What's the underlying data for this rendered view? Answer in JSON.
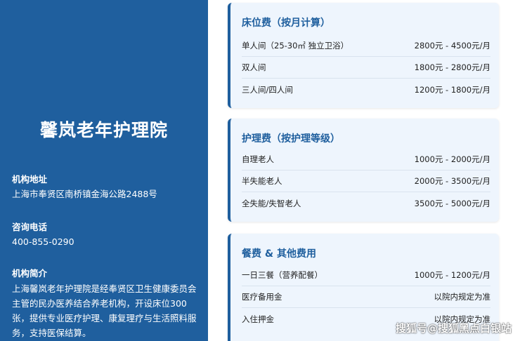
{
  "org": {
    "name": "馨岚老年护理院",
    "address_label": "机构地址",
    "address": "上海市奉贤区南桥镇金海公路2488号",
    "phone_label": "咨询电话",
    "phone": "400-855-0290",
    "intro_label": "机构简介",
    "intro": "上海馨岚老年护理院是经奉贤区卫生健康委员会主管的民办医养结合养老机构，开设床位300张，提供专业医疗护理、康复理疗与生活照料服务，支持医保结算。"
  },
  "cards": [
    {
      "title": "床位费（按月计算）",
      "rows": [
        {
          "name": "单人间（25-30㎡ 独立卫浴）",
          "price": "2800元 - 4500元/月"
        },
        {
          "name": "双人间",
          "price": "1800元 - 2800元/月"
        },
        {
          "name": "三人间/四人间",
          "price": "1200元 - 1800元/月"
        }
      ]
    },
    {
      "title": "护理费（按护理等级）",
      "rows": [
        {
          "name": "自理老人",
          "price": "1000元 - 2000元/月"
        },
        {
          "name": "半失能老人",
          "price": "2000元 - 3500元/月"
        },
        {
          "name": "全失能/失智老人",
          "price": "3500元 - 5000元/月"
        }
      ]
    },
    {
      "title": "餐费 & 其他费用",
      "rows": [
        {
          "name": "一日三餐（营养配餐）",
          "price": "1000元 - 1200元/月"
        },
        {
          "name": "医疗备用金",
          "price": "以院内规定为准"
        },
        {
          "name": "入住押金",
          "price": "以院内规定为准"
        }
      ]
    }
  ],
  "watermark": "搜狐号@搜狐黑点白银站",
  "colors": {
    "primary": "#1f5f9e",
    "card_bg": "#eef5fd"
  }
}
